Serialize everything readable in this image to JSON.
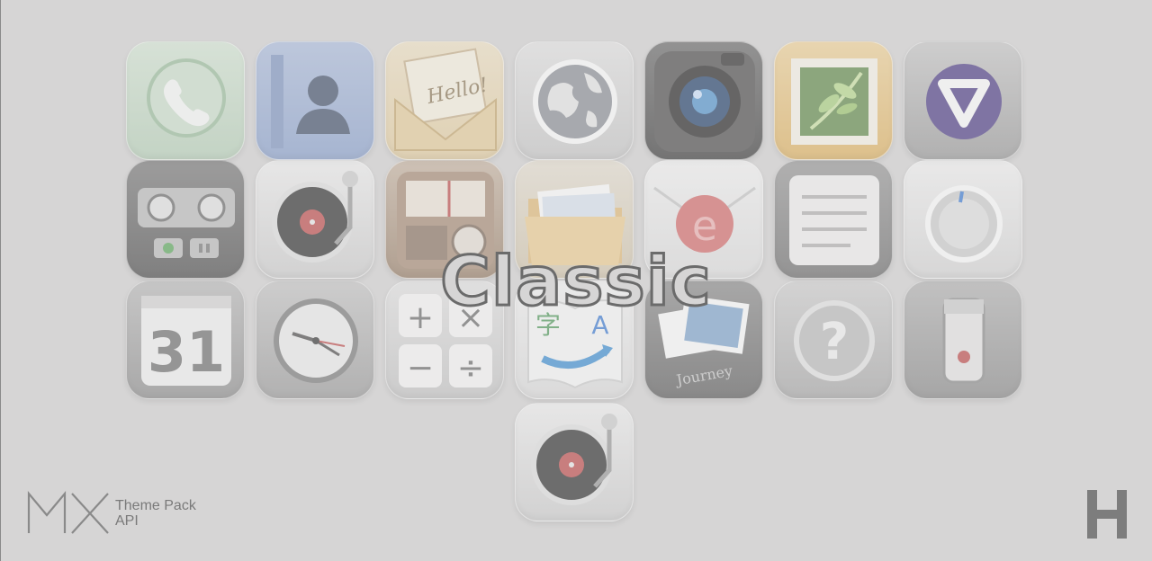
{
  "headline": "Classic",
  "brand": {
    "mark": "MX",
    "line1": "Theme Pack",
    "line2": "API"
  },
  "corner_logo": "H",
  "icons": {
    "phone": "phone-icon",
    "contacts": "contacts-icon",
    "mail": "mail-icon",
    "mail_text": "Hello!",
    "browser": "globe-icon",
    "camera": "camera-icon",
    "gallery": "photo-frame-icon",
    "video": "video-player-icon",
    "recorder": "cassette-recorder-icon",
    "music": "turntable-icon",
    "radio": "radio-icon",
    "files": "folder-icon",
    "email": "wax-seal-icon",
    "email_glyph": "e",
    "notes": "notepad-icon",
    "settings": "dial-knob-icon",
    "calendar": "calendar-icon",
    "calendar_day": "31",
    "clock": "clock-icon",
    "calculator": "calculator-icon",
    "calc_plus": "+",
    "calc_times": "×",
    "calc_minus": "−",
    "calc_divide": "÷",
    "translate": "translate-book-icon",
    "translate_glyph": "字",
    "translate_letter": "A",
    "journey": "journey-album-icon",
    "journey_text": "Journey",
    "help": "help-icon",
    "help_glyph": "?",
    "flashlight": "flashlight-icon",
    "music_extra": "turntable-icon"
  },
  "colors": {
    "background": "#d6d5d5",
    "headline_stroke": "#6b6b6b",
    "brand_text": "#7a7a7a",
    "record_red": "#c04a4a",
    "seal_red": "#d66a6a"
  }
}
